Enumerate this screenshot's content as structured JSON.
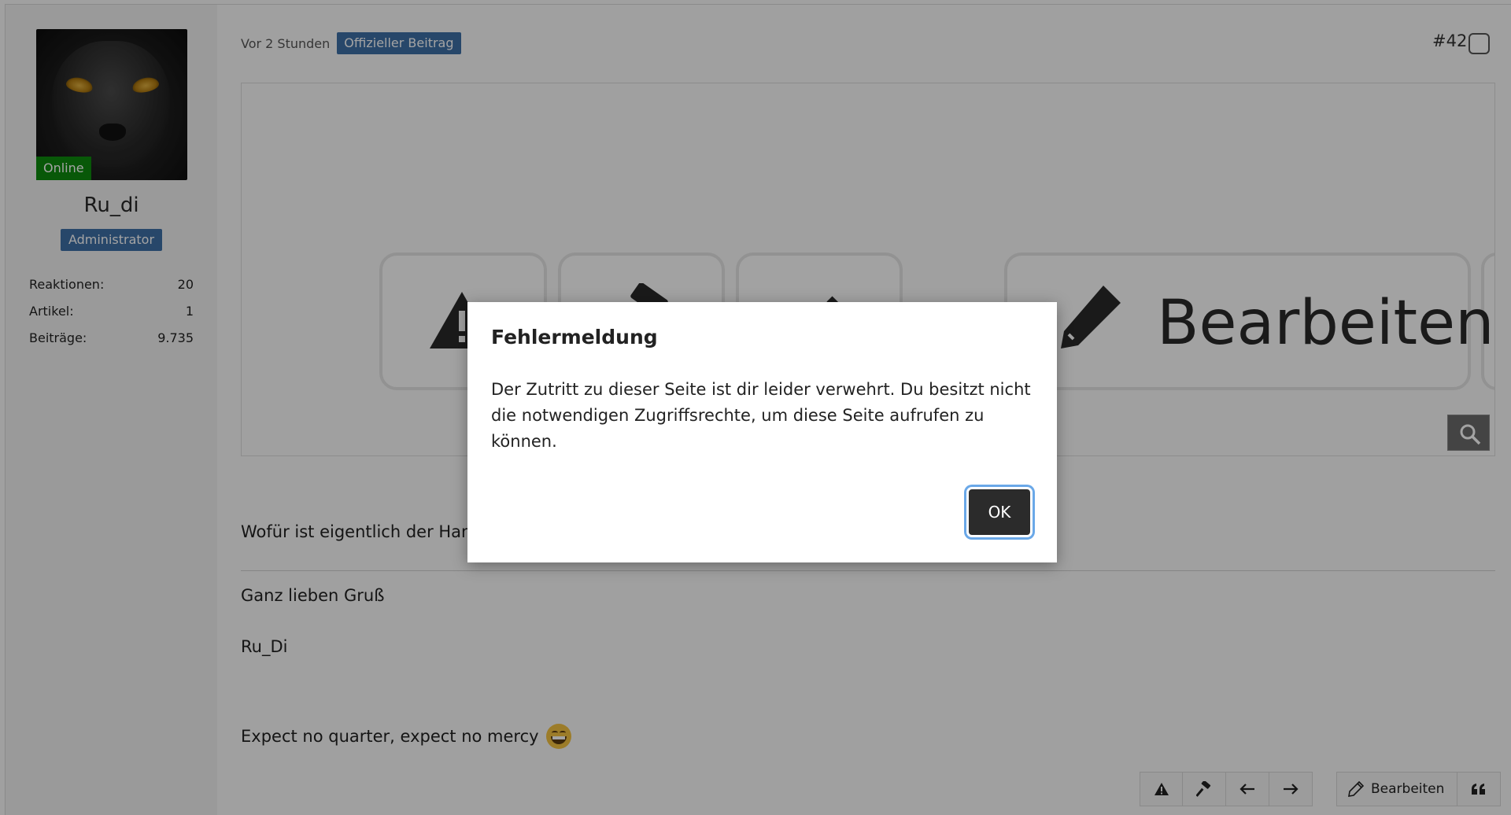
{
  "sidebar": {
    "online_badge": "Online",
    "username": "Ru_di",
    "role": "Administrator",
    "stats": [
      {
        "label": "Reaktionen:",
        "value": "20"
      },
      {
        "label": "Artikel:",
        "value": "1"
      },
      {
        "label": "Beiträge:",
        "value": "9.735"
      }
    ]
  },
  "post": {
    "time": "Vor 2 Stunden",
    "official_badge": "Offizieller Beitrag",
    "number": "#42",
    "image_button_label": "Bearbeiten",
    "line1": "Wofür ist eigentlich der Ham",
    "greeting": "Ganz lieben Gruß",
    "signature_name": "Ru_Di",
    "tagline": "Expect no quarter, expect no mercy"
  },
  "toolbar": {
    "icons": [
      "warning-icon",
      "hammer-icon",
      "arrow-left-icon",
      "arrow-right-icon"
    ],
    "edit_label": "Bearbeiten",
    "quote_icon": "quote-icon"
  },
  "modal": {
    "title": "Fehlermeldung",
    "body": "Der Zutritt zu dieser Seite ist dir leider verwehrt. Du besitzt nicht die notwendigen Zugriffsrechte, um diese Seite aufrufen zu können.",
    "ok_label": "OK"
  },
  "colors": {
    "accent_blue": "#3e6fa6",
    "online_green": "#0e8a0e",
    "ok_button": "#2b2b2b",
    "focus_ring": "#6aa8e8"
  }
}
